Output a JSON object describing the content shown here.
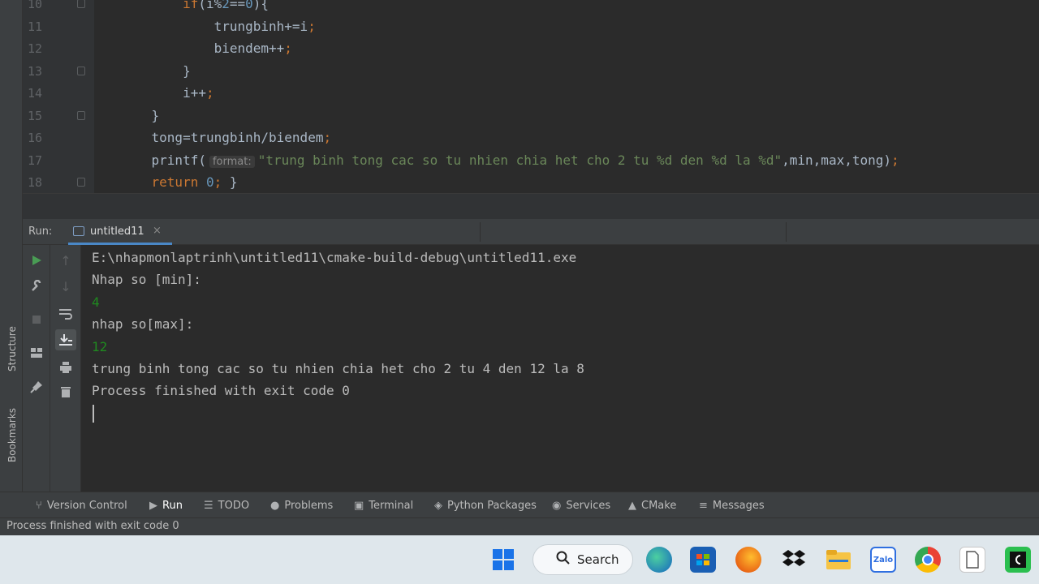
{
  "side_labels": {
    "structure": "Structure",
    "bookmarks": "Bookmarks"
  },
  "editor": {
    "lines": [
      {
        "n": "10",
        "segments": [
          {
            "t": "        "
          },
          {
            "t": "if",
            "c": "kw"
          },
          {
            "t": "(i%"
          },
          {
            "t": "2",
            "c": "num"
          },
          {
            "t": "=="
          },
          {
            "t": "0",
            "c": "num"
          },
          {
            "t": "){"
          }
        ]
      },
      {
        "n": "11",
        "segments": [
          {
            "t": "            trungbinh+=i"
          },
          {
            "t": ";",
            "c": "kw"
          }
        ]
      },
      {
        "n": "12",
        "segments": [
          {
            "t": "            biendem++"
          },
          {
            "t": ";",
            "c": "kw"
          }
        ]
      },
      {
        "n": "13",
        "segments": [
          {
            "t": "        }"
          }
        ]
      },
      {
        "n": "14",
        "segments": [
          {
            "t": "        i++"
          },
          {
            "t": ";",
            "c": "kw"
          }
        ]
      },
      {
        "n": "15",
        "segments": [
          {
            "t": "    }"
          }
        ]
      },
      {
        "n": "16",
        "segments": [
          {
            "t": "    tong=trungbinh/biendem"
          },
          {
            "t": ";",
            "c": "kw"
          }
        ]
      },
      {
        "n": "17",
        "segments": [
          {
            "t": "    printf("
          },
          {
            "t": "format:",
            "c": "hint"
          },
          {
            "t": "\"trung binh tong cac so tu nhien chia het cho 2 tu %d den %d la %d\"",
            "c": "str"
          },
          {
            "t": ",min,max,tong)"
          },
          {
            "t": ";",
            "c": "kw"
          }
        ]
      },
      {
        "n": "18",
        "segments": [
          {
            "t": "    "
          },
          {
            "t": "return",
            "c": "kw"
          },
          {
            "t": " "
          },
          {
            "t": "0",
            "c": "num"
          },
          {
            "t": ";",
            "c": "kw"
          },
          {
            "t": " }"
          }
        ]
      }
    ]
  },
  "run": {
    "label": "Run:",
    "tab_label": "untitled11",
    "tab_close": "×",
    "console": [
      {
        "text": "E:\\nhapmonlaptrinh\\untitled11\\cmake-build-debug\\untitled11.exe",
        "input": false
      },
      {
        "text": "Nhap so [min]:",
        "input": false
      },
      {
        "text": "4",
        "input": true
      },
      {
        "text": "nhap so[max]:",
        "input": false
      },
      {
        "text": "12",
        "input": true
      },
      {
        "text": "trung binh tong cac so tu nhien chia het cho 2 tu 4 den 12 la 8",
        "input": false
      },
      {
        "text": "Process finished with exit code 0",
        "input": false
      }
    ]
  },
  "tool_tabs": [
    {
      "label": "Version Control",
      "icon": "branch-icon",
      "glyph": "⑂"
    },
    {
      "label": "Run",
      "icon": "run-icon",
      "glyph": "▶",
      "active": true
    },
    {
      "label": "TODO",
      "icon": "list-icon",
      "glyph": "☰"
    },
    {
      "label": "Problems",
      "icon": "info-icon",
      "glyph": "●"
    },
    {
      "label": "Terminal",
      "icon": "terminal-icon",
      "glyph": "▣"
    },
    {
      "label": "Python Packages",
      "icon": "layers-icon",
      "glyph": "◈"
    },
    {
      "label": "Services",
      "icon": "services-icon",
      "glyph": "◉"
    },
    {
      "label": "CMake",
      "icon": "cmake-icon",
      "glyph": "▲"
    },
    {
      "label": "Messages",
      "icon": "messages-icon",
      "glyph": "≡"
    }
  ],
  "status": {
    "text": "Process finished with exit code 0"
  },
  "taskbar": {
    "search_label": "Search",
    "zalo_label": "Zalo",
    "colors": {
      "accent": "#4a88c7",
      "run_green": "#499c54",
      "console_input": "#1f8a1f"
    }
  }
}
